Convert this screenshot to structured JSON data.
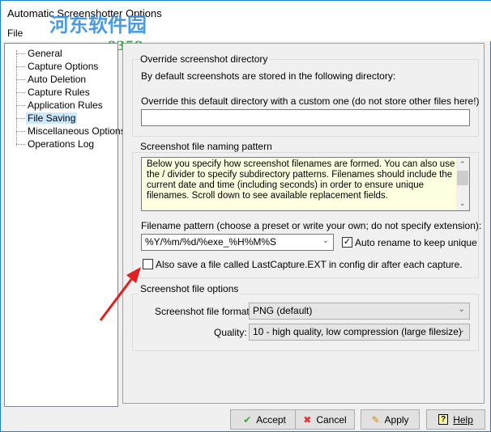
{
  "window": {
    "title": "Automatic Screenshotter Options"
  },
  "menu": {
    "file": "File"
  },
  "watermark": {
    "line1": "河东软件园",
    "line2": "www.pc0359.cn"
  },
  "tree": {
    "items": [
      {
        "label": "General"
      },
      {
        "label": "Capture Options"
      },
      {
        "label": "Auto Deletion"
      },
      {
        "label": "Capture Rules"
      },
      {
        "label": "Application Rules"
      },
      {
        "label": "File Saving",
        "selected": true
      },
      {
        "label": "Miscellaneous Options"
      },
      {
        "label": "Operations Log"
      }
    ]
  },
  "override": {
    "group_label": "Override screenshot directory",
    "info": "By default screenshots are stored in the following directory:",
    "custom_label": "Override this default directory with a custom one (do not store other files here!)",
    "custom_value": ""
  },
  "naming": {
    "group_label": "Screenshot file naming pattern",
    "description": "Below you specify how screenshot filenames are formed.  You can also use the / divider to specify subdirectory patterns.  Filenames should include the current date and time (including seconds) in order to ensure unique filenames.  Scroll down to see available replacement fields.",
    "pattern_label": "Filename pattern (choose a preset or write your own; do not specify extension):",
    "pattern_value": "%Y/%m/%d/%exe_%H%M%S",
    "auto_rename_label": "Auto rename to keep unique",
    "auto_rename_checked": true,
    "last_capture_label": "Also save a file called LastCapture.EXT in config dir after each capture.",
    "last_capture_checked": false
  },
  "file_options": {
    "group_label": "Screenshot file options",
    "format_label": "Screenshot file format:",
    "format_value": "PNG (default)",
    "quality_label": "Quality:",
    "quality_value": "10 - high quality, low compression (large filesize)"
  },
  "buttons": {
    "accept": "Accept",
    "cancel": "Cancel",
    "apply": "Apply",
    "help": "Help"
  },
  "colors": {
    "arrow": "#e02020",
    "selection": "#cce8ff",
    "description_bg": "#ffffe1"
  }
}
